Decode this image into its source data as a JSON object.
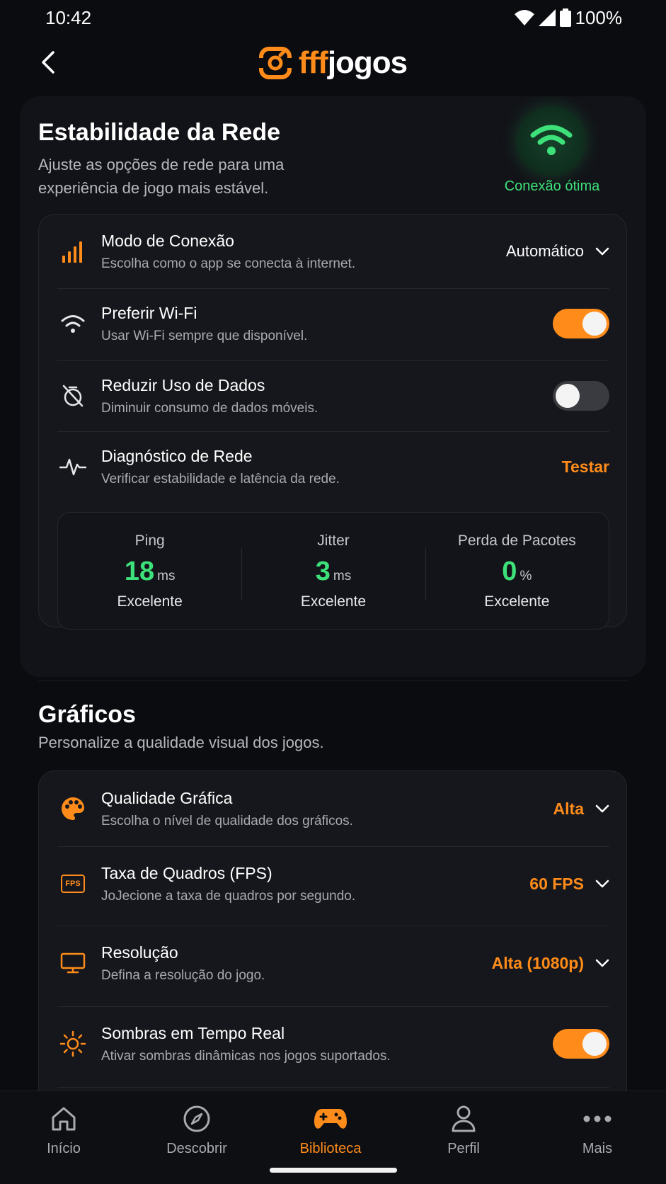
{
  "status": {
    "time": "10:42",
    "battery": "100%"
  },
  "header": {
    "logo_part1": "fff",
    "logo_part2": "jogos"
  },
  "network": {
    "title": "Estabilidade da Rede",
    "subtitle": "Ajuste as opções de rede para uma experiência de jogo mais estável.",
    "connection_status": "Conexão ótima",
    "rows": [
      {
        "title": "Modo de Conexão",
        "desc": "Escolha como o app se conecta à internet.",
        "value": "Automático",
        "icon": "signal-bars-icon"
      },
      {
        "title": "Preferir Wi-Fi",
        "desc": "Usar Wi-Fi sempre que disponível.",
        "toggle": true,
        "icon": "wifi-icon"
      },
      {
        "title": "Reduzir Uso de Dados",
        "desc": "Diminuir consumo de dados móveis.",
        "toggle": false,
        "icon": "data-off-icon"
      },
      {
        "title": "Diagnóstico de Rede",
        "desc": "Verificar estabilidade e latência da rede.",
        "action": "Testar",
        "icon": "pulse-icon"
      }
    ],
    "stats": [
      {
        "label": "Ping",
        "value": "18",
        "unit": "ms",
        "grade": "Excelente"
      },
      {
        "label": "Jitter",
        "value": "3",
        "unit": "ms",
        "grade": "Excelente"
      },
      {
        "label": "Perda de Pacotes",
        "value": "0",
        "unit": "%",
        "grade": "Excelente"
      }
    ]
  },
  "graphics": {
    "title": "Gráficos",
    "subtitle": "Personalize a qualidade visual dos jogos.",
    "rows": [
      {
        "title": "Qualidade Gráfica",
        "desc": "Escolha o nível de qualidade dos gráficos.",
        "value": "Alta",
        "icon": "palette-icon"
      },
      {
        "title": "Taxa de Quadros (FPS)",
        "desc": "JoJecione a taxa de quadros por segundo.",
        "value": "60 FPS",
        "icon": "fps-icon",
        "icon_text": "FPS"
      },
      {
        "title": "Resolução",
        "desc": "Defina a resolução do jogo.",
        "value": "Alta (1080p)",
        "icon": "monitor-icon"
      },
      {
        "title": "Sombras em Tempo Real",
        "desc": "Ativar sombras dinâmicas nos jogos suportados.",
        "toggle": true,
        "icon": "sun-icon"
      }
    ]
  },
  "nav": [
    {
      "label": "Início",
      "icon": "home-icon"
    },
    {
      "label": "Descobrir",
      "icon": "compass-icon"
    },
    {
      "label": "Biblioteca",
      "icon": "gamepad-icon",
      "active": true
    },
    {
      "label": "Perfil",
      "icon": "profile-icon"
    },
    {
      "label": "Mais",
      "icon": "more-icon"
    }
  ],
  "colors": {
    "accent": "#ff8c1a",
    "success": "#3ee07a",
    "background": "#0b0c10"
  }
}
